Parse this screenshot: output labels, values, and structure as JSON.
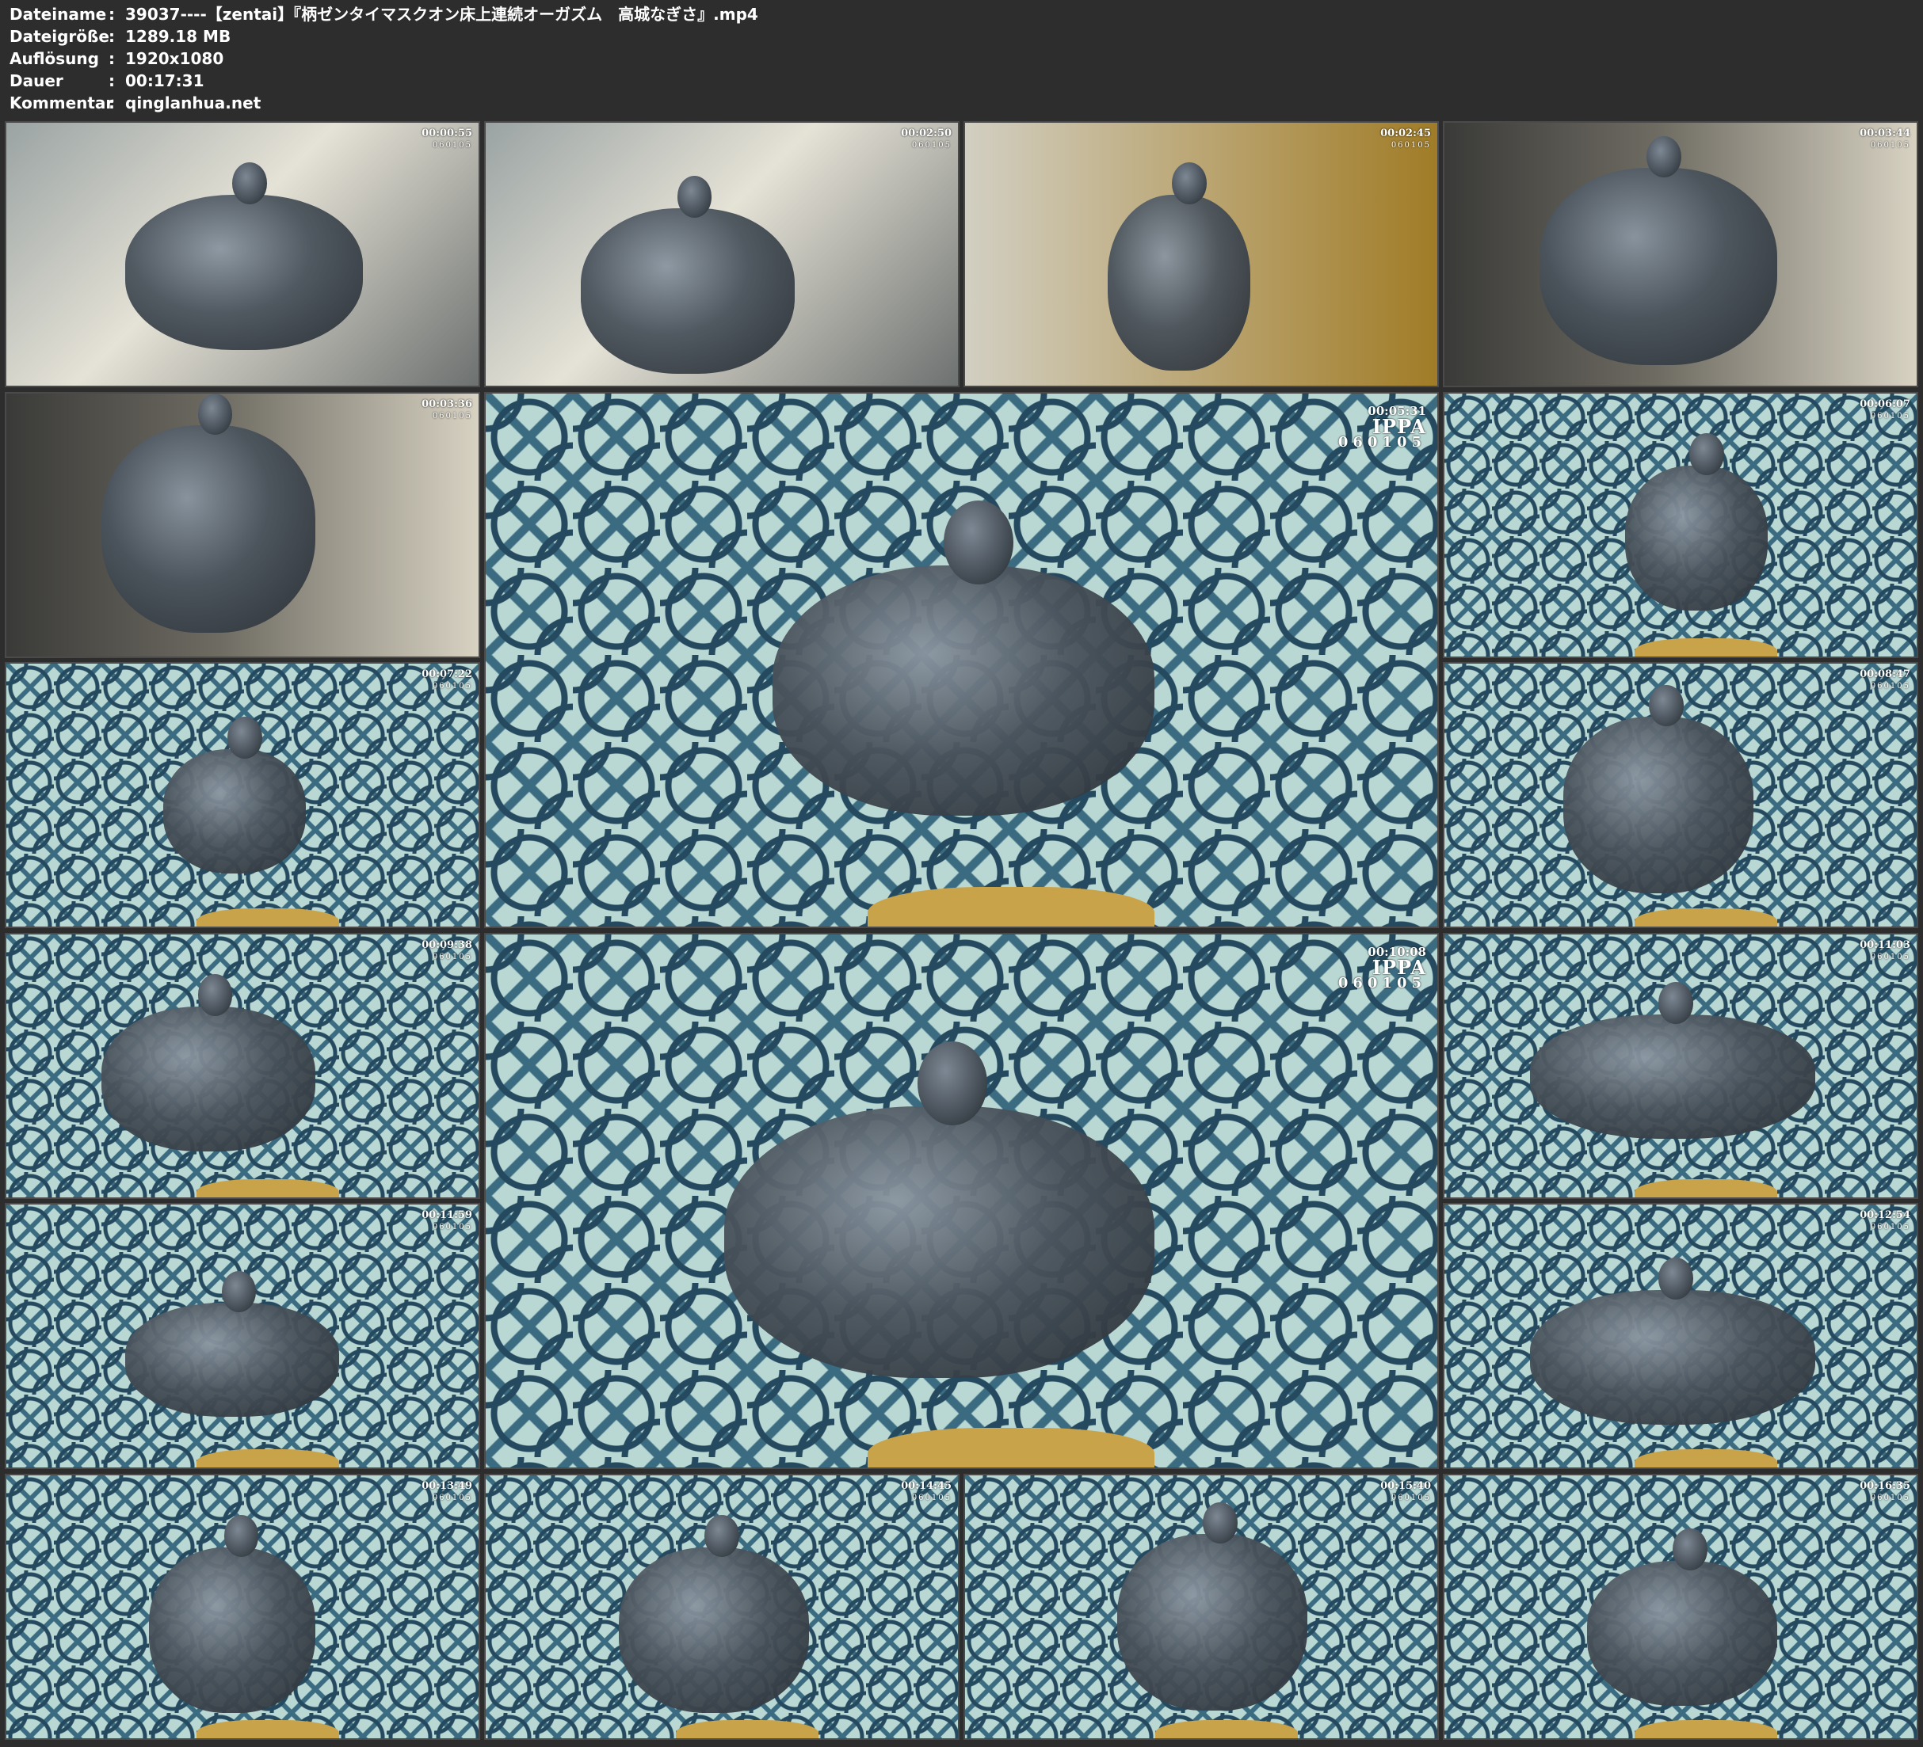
{
  "header": {
    "rows": [
      {
        "label": "Dateiname",
        "sep": ":",
        "value": "39037----【zentai】『柄ゼンタイマスクオン床上連続オーガズム　高城なぎさ』.mp4"
      },
      {
        "label": "Dateigröße",
        "sep": ":",
        "value": "1289.18 MB"
      },
      {
        "label": "Auflösung",
        "sep": ":",
        "value": "1920x1080"
      },
      {
        "label": "Dauer",
        "sep": ":",
        "value": "00:17:31"
      },
      {
        "label": "Kommentar",
        "sep": ":",
        "value": "qinglanhua.net"
      }
    ]
  },
  "thumbnails": [
    {
      "time": "00:00:55",
      "code": "060105",
      "scene": "room"
    },
    {
      "time": "00:02:50",
      "code": "060105",
      "scene": "room"
    },
    {
      "time": "00:02:45",
      "code": "060105",
      "scene": "room-warm"
    },
    {
      "time": "00:03:44",
      "code": "060105",
      "scene": "room-dark"
    },
    {
      "time": "00:03:36",
      "code": "060105",
      "scene": "room-dark"
    },
    {
      "time": "00:05:31",
      "code": "060105",
      "scene": "floor",
      "logo": "IPPA"
    },
    {
      "time": "00:06:07",
      "code": "060105",
      "scene": "floor"
    },
    {
      "time": "00:07:22",
      "code": "060105",
      "scene": "floor"
    },
    {
      "time": "00:08:47",
      "code": "060105",
      "scene": "floor"
    },
    {
      "time": "00:09:38",
      "code": "060105",
      "scene": "floor"
    },
    {
      "time": "00:10:08",
      "code": "060105",
      "scene": "floor",
      "logo": "IPPA"
    },
    {
      "time": "00:11:03",
      "code": "060105",
      "scene": "floor"
    },
    {
      "time": "00:11:59",
      "code": "060105",
      "scene": "floor"
    },
    {
      "time": "00:12:54",
      "code": "060105",
      "scene": "floor"
    },
    {
      "time": "00:13:49",
      "code": "060105",
      "scene": "floor"
    },
    {
      "time": "00:14:45",
      "code": "060105",
      "scene": "floor"
    },
    {
      "time": "00:15:40",
      "code": "060105",
      "scene": "floor"
    },
    {
      "time": "00:16:35",
      "code": "060105",
      "scene": "floor"
    }
  ]
}
